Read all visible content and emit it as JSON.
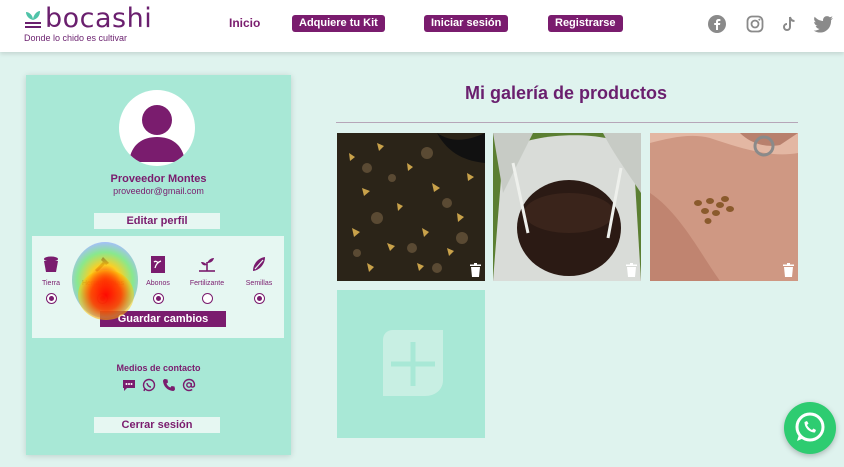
{
  "brand": {
    "name": "bocashi",
    "tagline": "Donde lo chido es cultivar"
  },
  "nav": {
    "home": "Inicio",
    "kit": "Adquiere tu Kit",
    "login": "Iniciar sesión",
    "register": "Registrarse"
  },
  "social": [
    "facebook-icon",
    "instagram-icon",
    "tiktok-icon",
    "twitter-icon"
  ],
  "profile": {
    "name": "Proveedor Montes",
    "email": "proveedor@gmail.com",
    "edit_label": "Editar perfil",
    "categories": [
      {
        "label": "Tierra",
        "selected": true
      },
      {
        "label": "Herramientas",
        "selected": true
      },
      {
        "label": "Abonos",
        "selected": true
      },
      {
        "label": "Fertilizante",
        "selected": false
      },
      {
        "label": "Semillas",
        "selected": true
      }
    ],
    "save_label": "Guardar cambios",
    "contact_title": "Medios de contacto",
    "contact_icons": [
      "sms-icon",
      "whatsapp-icon",
      "phone-icon",
      "email-at-icon"
    ],
    "logout_label": "Cerrar sesión"
  },
  "gallery": {
    "title": "Mi galería de productos",
    "product_count": 3
  },
  "colors": {
    "primary": "#7a1c6e",
    "panel": "#a8e8d6",
    "background": "#dff3ee",
    "light": "#e6f7f2",
    "whatsapp": "#2ecc71"
  }
}
